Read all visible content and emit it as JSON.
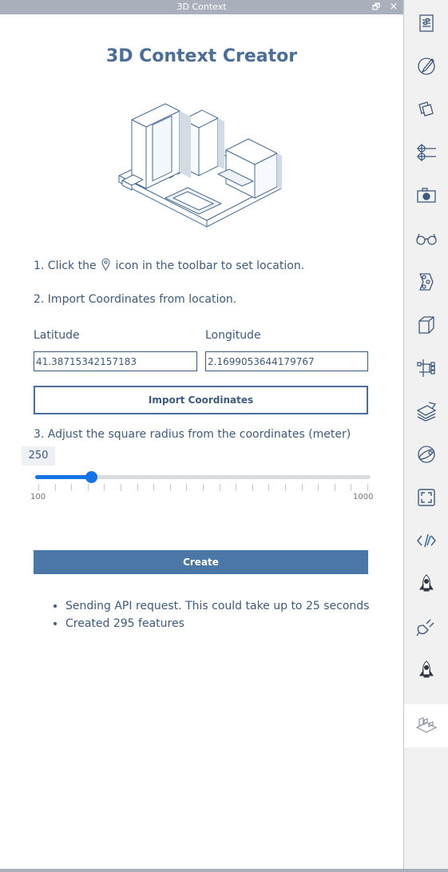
{
  "window": {
    "title": "3D Context",
    "restore_glyph": "🗗",
    "close_glyph": "×"
  },
  "panel": {
    "title": "3D Context Creator",
    "step1_before": "1. Click the",
    "step1_after": "icon in the toolbar to set location.",
    "step2": "2. Import Coordinates from location.",
    "latitude_label": "Latitude",
    "longitude_label": "Longitude",
    "latitude_value": "41.38715342157183",
    "longitude_value": "2.1699053644179767",
    "import_button": "Import Coordinates",
    "step3": "3. Adjust the square radius from the coordinates (meter)",
    "radius_value": "250",
    "slider": {
      "min": 100,
      "max": 1000,
      "value": 250,
      "min_label": "100",
      "max_label": "1000"
    },
    "create_button": "Create",
    "status": [
      "Sending API request. This could take up to 25 seconds",
      "Created 295 features"
    ]
  },
  "toolbar": {
    "icons": [
      "panel-settings-icon",
      "brush-icon",
      "layers-icon",
      "node-graph-icon",
      "camera-icon",
      "glasses-icon",
      "robot-arm-icon",
      "cube-icon",
      "tree-structure-icon",
      "stack-edit-icon",
      "sphere-icon",
      "fullscreen-icon",
      "code-icon",
      "rocket-icon",
      "plug-icon",
      "rocket-icon-2",
      "3d-context-icon"
    ],
    "active_icon": "3d-context-icon"
  },
  "colors": {
    "accent": "#4a76a8",
    "text": "#3d5a7f",
    "slider": "#1473e6",
    "titlebar": "#a9b0bb"
  }
}
